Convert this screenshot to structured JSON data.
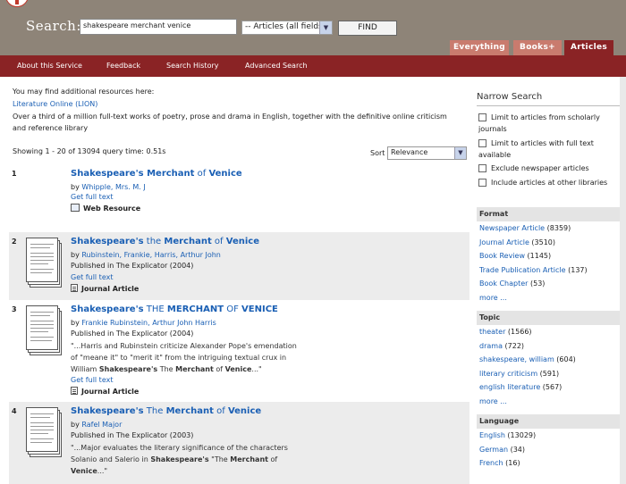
{
  "search": {
    "label": "Search:",
    "query": "shakespeare merchant venice",
    "field": "-- Articles (all fields)",
    "find_label": "FIND"
  },
  "tabs": [
    {
      "label": "Everything"
    },
    {
      "label": "Books+"
    },
    {
      "label": "Articles"
    }
  ],
  "nav": [
    {
      "label": "About this Service"
    },
    {
      "label": "Feedback"
    },
    {
      "label": "Search History"
    },
    {
      "label": "Advanced Search"
    }
  ],
  "resources": {
    "note": "You may find additional resources here:",
    "link": "Literature Online (LION)",
    "description": "Over a third of a million full-text works of poetry, prose and drama in English, together with the definitive online criticism and reference library"
  },
  "summary": {
    "showing": "Showing 1 - 20 of 13094 query time: 0.51s",
    "sort_label": "Sort",
    "sort_value": "Relevance"
  },
  "results": [
    {
      "num": "1",
      "title_a": "Shakespeare's Merchant",
      "title_b": " of ",
      "title_c": "Venice",
      "by_label": "by ",
      "authors": "Whipple, Mrs. M. J",
      "published": "",
      "snippet": "",
      "fulltext": "Get full text",
      "type": "Web Resource"
    },
    {
      "num": "2",
      "title_a": "Shakespeare's",
      "title_b": " the ",
      "title_c": "Merchant",
      "title_d": " of ",
      "title_e": "Venice",
      "by_label": "by ",
      "authors": "Rubinstein, Frankie, Harris, Arthur John",
      "published": "Published in The Explicator (2004)",
      "fulltext": "Get full text",
      "type": "Journal Article"
    },
    {
      "num": "3",
      "title_a": "Shakespeare's",
      "title_b": " THE ",
      "title_c": "MERCHANT",
      "title_d": " OF ",
      "title_e": "VENICE",
      "by_label": "by ",
      "authors": "Frankie Rubinstein, Arthur John Harris",
      "published": "Published in The Explicator (2004)",
      "snippet_1": "\"...Harris and Rubinstein criticize Alexander Pope's emendation",
      "snippet_2": "of \"meane it\" to \"merit it\" from the intriguing textual crux in",
      "snippet_3a": "William ",
      "snippet_3b": "Shakespeare's",
      "snippet_3c": " The ",
      "snippet_3d": "Merchant",
      "snippet_3e": " of ",
      "snippet_3f": "Venice",
      "snippet_3g": "...\"",
      "fulltext": "Get full text",
      "type": "Journal Article"
    },
    {
      "num": "4",
      "title_a": "Shakespeare's",
      "title_b": " The ",
      "title_c": "Merchant",
      "title_d": " of ",
      "title_e": "Venice",
      "by_label": "by ",
      "authors": "Rafel Major",
      "published": "Published in The Explicator (2003)",
      "snippet_1": "\"...Major evaluates the literary significance of the characters",
      "snippet_2a": "Solanio and Salerio in ",
      "snippet_2b": "Shakespeare's",
      "snippet_2c": " \"The ",
      "snippet_2d": "Merchant",
      "snippet_2e": " of",
      "snippet_3a": "Venice",
      "snippet_3b": "...\""
    }
  ],
  "sidebar": {
    "title": "Narrow Search",
    "limits": [
      "Limit to articles from scholarly journals",
      "Limit to articles with full text available",
      "Exclude newspaper articles",
      "Include articles at other libraries"
    ],
    "format": {
      "header": "Format",
      "items": [
        {
          "label": "Newspaper Article",
          "count": " (8359)"
        },
        {
          "label": "Journal Article",
          "count": " (3510)"
        },
        {
          "label": "Book Review",
          "count": " (1145)"
        },
        {
          "label": "Trade Publication Article",
          "count": " (137)"
        },
        {
          "label": "Book Chapter",
          "count": " (53)"
        }
      ],
      "more": "more ..."
    },
    "topic": {
      "header": "Topic",
      "items": [
        {
          "label": "theater",
          "count": " (1566)"
        },
        {
          "label": "drama",
          "count": " (722)"
        },
        {
          "label": "shakespeare, william",
          "count": " (604)"
        },
        {
          "label": "literary criticism",
          "count": " (591)"
        },
        {
          "label": "english literature",
          "count": " (567)"
        }
      ],
      "more": "more ..."
    },
    "language": {
      "header": "Language",
      "items": [
        {
          "label": "English",
          "count": " (13029)"
        },
        {
          "label": "German",
          "count": " (34)"
        },
        {
          "label": "French",
          "count": " (16)"
        }
      ]
    }
  },
  "colors": {
    "header": "#8e8478",
    "nav": "#8a2325",
    "tab_inactive": "#c97b6e",
    "link": "#1a5fb4"
  }
}
